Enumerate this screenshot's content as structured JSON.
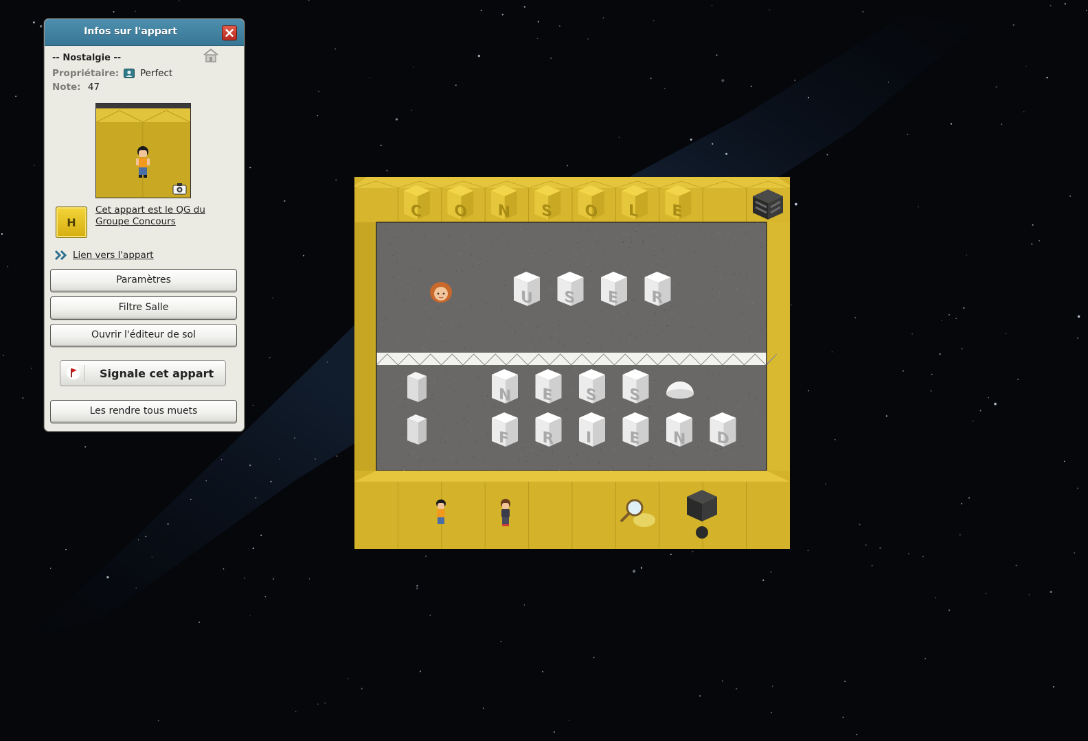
{
  "window": {
    "title": "Infos sur l'appart"
  },
  "room": {
    "name": "-- Nostalgie --",
    "owner_label": "Propriétaire:",
    "owner_name": "Perfect",
    "rating_label": "Note:",
    "rating_value": "47",
    "group_badge_letter": "H",
    "group_text": "Cet appart est le QG du Groupe Concours",
    "room_link": "Lien vers l'appart"
  },
  "buttons": {
    "settings": "Paramètres",
    "filter": "Filtre Salle",
    "floor_editor": "Ouvrir l'éditeur de sol",
    "report": "Signale cet appart",
    "mute_all": "Les rendre tous muets"
  },
  "room_view": {
    "wall_letters": [
      "C",
      "O",
      "N",
      "S",
      "O",
      "L",
      "E"
    ],
    "row1_letters": [
      "U",
      "S",
      "E",
      "R"
    ],
    "row2_letters": [
      "N",
      "E",
      "S",
      "S"
    ],
    "row3_letters": [
      "F",
      "R",
      "I",
      "E",
      "N",
      "D"
    ]
  },
  "colors": {
    "header": "#377795",
    "gold": "#d4b32a",
    "floor": "#6a6866",
    "close": "#c4352a",
    "background": "#05070b"
  }
}
